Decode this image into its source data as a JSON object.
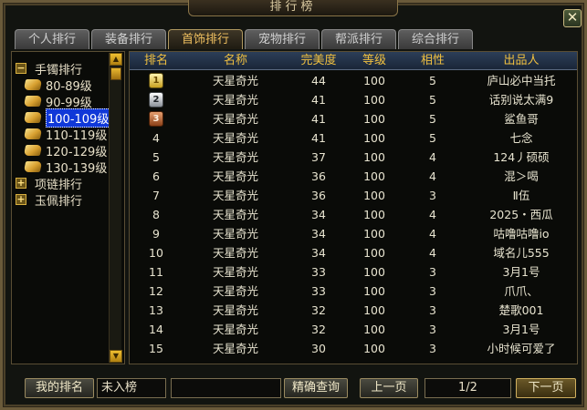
{
  "window": {
    "title": "排行榜",
    "close_glyph": "✕"
  },
  "tabs": [
    {
      "label": "个人排行",
      "active": false
    },
    {
      "label": "装备排行",
      "active": false
    },
    {
      "label": "首饰排行",
      "active": true
    },
    {
      "label": "宠物排行",
      "active": false
    },
    {
      "label": "帮派排行",
      "active": false
    },
    {
      "label": "综合排行",
      "active": false
    }
  ],
  "tree": {
    "expand_glyph": "−",
    "collapse_glyph": "+",
    "category_bracelet": "手镯排行",
    "leaves": [
      "80-89级",
      "90-99级",
      "100-109级",
      "110-119级",
      "120-129级",
      "130-139级"
    ],
    "selected_leaf": "100-109级",
    "category_necklace": "项链排行",
    "category_pendant": "玉佩排行"
  },
  "table": {
    "headers": [
      "排名",
      "名称",
      "完美度",
      "等级",
      "相性",
      "出品人"
    ],
    "rows": [
      [
        "1",
        "天星奇光",
        "44",
        "100",
        "5",
        "庐山必中当托"
      ],
      [
        "2",
        "天星奇光",
        "41",
        "100",
        "5",
        "话别说太满9"
      ],
      [
        "3",
        "天星奇光",
        "41",
        "100",
        "5",
        "鲨鱼哥"
      ],
      [
        "4",
        "天星奇光",
        "41",
        "100",
        "5",
        "七念"
      ],
      [
        "5",
        "天星奇光",
        "37",
        "100",
        "4",
        "124丿硕硕"
      ],
      [
        "6",
        "天星奇光",
        "36",
        "100",
        "4",
        "混＞喝"
      ],
      [
        "7",
        "天星奇光",
        "36",
        "100",
        "3",
        "Ⅱ伍"
      ],
      [
        "8",
        "天星奇光",
        "34",
        "100",
        "4",
        "2025・西瓜"
      ],
      [
        "9",
        "天星奇光",
        "34",
        "100",
        "4",
        "咕噜咕噜io"
      ],
      [
        "10",
        "天星奇光",
        "34",
        "100",
        "4",
        "域名儿555"
      ],
      [
        "11",
        "天星奇光",
        "33",
        "100",
        "3",
        "3月1号"
      ],
      [
        "12",
        "天星奇光",
        "33",
        "100",
        "3",
        "爪爪、"
      ],
      [
        "13",
        "天星奇光",
        "32",
        "100",
        "3",
        "楚歌001"
      ],
      [
        "14",
        "天星奇光",
        "32",
        "100",
        "3",
        "3月1号"
      ],
      [
        "15",
        "天星奇光",
        "30",
        "100",
        "3",
        "小时候可爱了"
      ]
    ]
  },
  "scrollbar": {
    "up_glyph": "▲",
    "down_glyph": "▼"
  },
  "footer": {
    "my_rank_label": "我的排名",
    "my_rank_value": "未入榜",
    "search_value": "",
    "search_button": "精确查询",
    "prev_button": "上一页",
    "page_indicator": "1/2",
    "next_button": "下一页"
  }
}
